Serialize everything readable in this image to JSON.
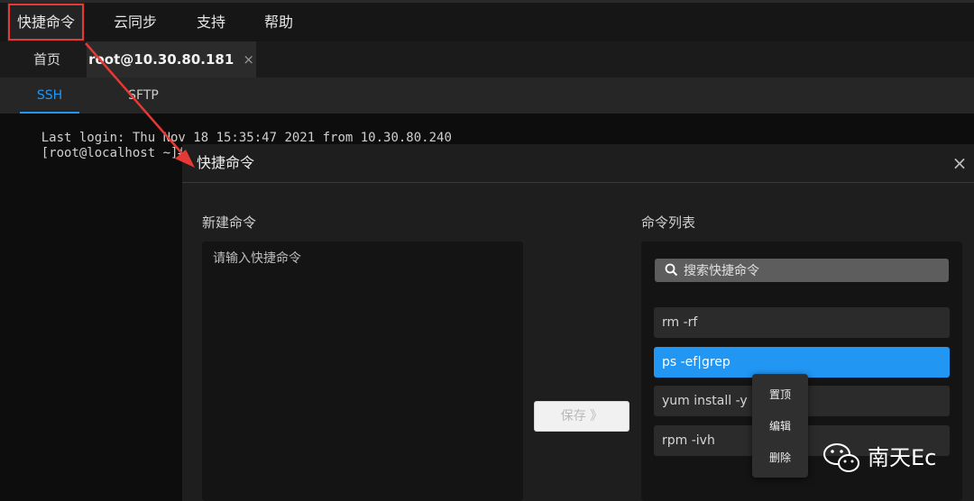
{
  "menubar": {
    "items": [
      {
        "label": "快捷命令",
        "active": true
      },
      {
        "label": "云同步"
      },
      {
        "label": "支持"
      },
      {
        "label": "帮助"
      }
    ]
  },
  "tabs": [
    {
      "label": "首页"
    },
    {
      "label": "root@10.30.80.181",
      "active": true,
      "close": "×"
    }
  ],
  "subtabs": [
    {
      "label": "SSH",
      "active": true
    },
    {
      "label": "SFTP"
    }
  ],
  "terminal": {
    "lines": [
      "Last login: Thu Nov 18 15:35:47 2021 from 10.30.80.240",
      "[root@localhost ~]#"
    ]
  },
  "dialog": {
    "title": "快捷命令",
    "close": "×",
    "new_command": {
      "label": "新建命令",
      "placeholder": "请输入快捷命令",
      "value": ""
    },
    "save_label": "保存 》",
    "command_list": {
      "label": "命令列表",
      "search_placeholder": "搜索快捷命令",
      "items": [
        {
          "text": "rm -rf"
        },
        {
          "text": "ps -ef|grep",
          "selected": true
        },
        {
          "text": "yum install -y"
        },
        {
          "text": "rpm -ivh"
        }
      ]
    }
  },
  "context_menu": {
    "items": [
      "置顶",
      "编辑",
      "删除"
    ]
  },
  "watermark": {
    "text": "南天Ec"
  },
  "colors": {
    "accent": "#2196f3",
    "highlight": "#e53935",
    "background": "#101010"
  }
}
